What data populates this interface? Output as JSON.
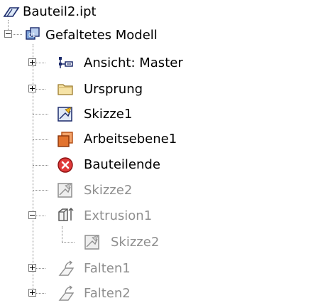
{
  "browser": {
    "root": {
      "label": "Bauteil2.ipt",
      "icon": "part-document-icon"
    },
    "model": {
      "label": "Gefaltetes Modell",
      "icon": "folded-model-icon",
      "expanded": true
    },
    "items": [
      {
        "label": "Ansicht: Master",
        "icon": "view-representation-icon",
        "expandable": true,
        "expanded": false,
        "suppressed": false
      },
      {
        "label": "Ursprung",
        "icon": "folder-icon",
        "expandable": true,
        "expanded": false,
        "suppressed": false
      },
      {
        "label": "Skizze1",
        "icon": "sketch-icon",
        "expandable": false,
        "suppressed": false
      },
      {
        "label": "Arbeitsebene1",
        "icon": "work-plane-icon",
        "expandable": false,
        "suppressed": false
      },
      {
        "label": "Bauteilende",
        "icon": "end-of-part-icon",
        "expandable": false,
        "suppressed": false
      },
      {
        "label": "Skizze2",
        "icon": "sketch-icon",
        "expandable": false,
        "suppressed": true
      },
      {
        "label": "Extrusion1",
        "icon": "extrusion-icon",
        "expandable": true,
        "expanded": true,
        "suppressed": true,
        "children": [
          {
            "label": "Skizze2",
            "icon": "sketch-icon",
            "suppressed": true
          }
        ]
      },
      {
        "label": "Falten1",
        "icon": "fold-icon",
        "expandable": true,
        "expanded": false,
        "suppressed": true
      },
      {
        "label": "Falten2",
        "icon": "fold-icon",
        "expandable": true,
        "expanded": false,
        "suppressed": true
      }
    ]
  }
}
